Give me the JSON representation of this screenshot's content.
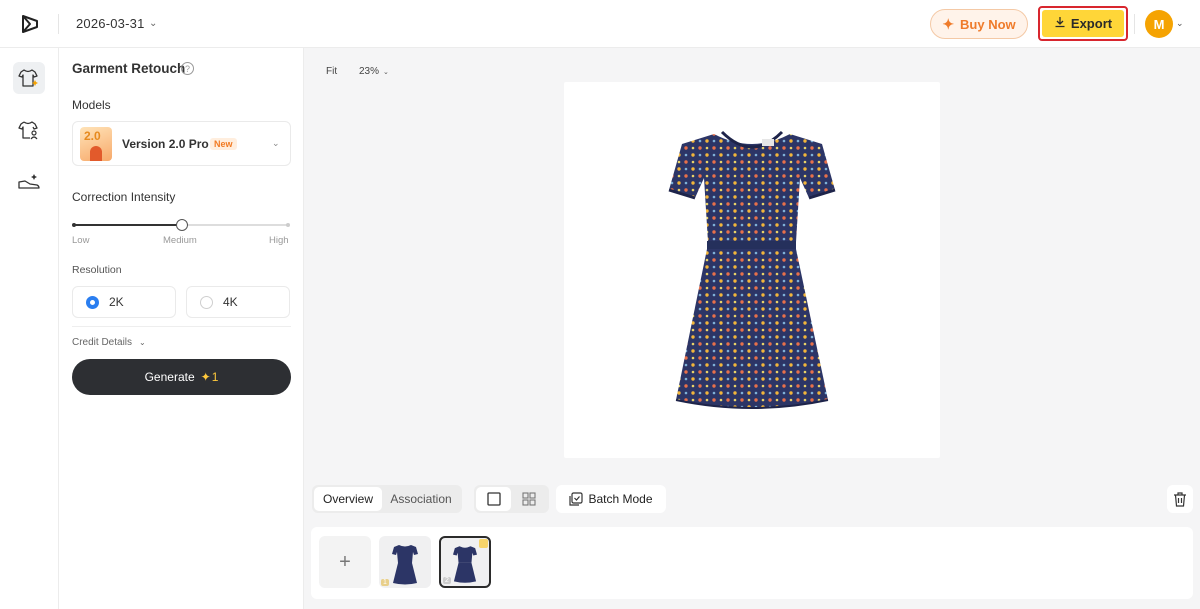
{
  "header": {
    "date": "2026-03-31",
    "buy_now": "Buy Now",
    "export": "Export",
    "avatar_initial": "M"
  },
  "rail": {
    "items": [
      "garment-retouch",
      "garment-model",
      "shoe-retouch"
    ]
  },
  "panel": {
    "title": "Garment Retouch",
    "models_label": "Models",
    "model": {
      "version_badge": "2.0",
      "name": "Version 2.0 Pro",
      "tag": "New"
    },
    "intensity_label": "Correction Intensity",
    "intensity_ticks": [
      "Low",
      "Medium",
      "High"
    ],
    "intensity_level": 0.5,
    "resolution_label": "Resolution",
    "resolutions": [
      {
        "label": "2K",
        "selected": true
      },
      {
        "label": "4K",
        "selected": false
      }
    ],
    "credit_details": "Credit Details",
    "generate": "Generate",
    "generate_cost": "1"
  },
  "toolbar": {
    "fit": "Fit",
    "zoom": "23%"
  },
  "bottom": {
    "tabs": [
      "Overview",
      "Association"
    ],
    "batch_mode": "Batch Mode",
    "thumbs": [
      {
        "index": "1",
        "selected": false
      },
      {
        "index": "2",
        "selected": true
      }
    ]
  },
  "colors": {
    "accent_yellow": "#ffd638",
    "accent_orange": "#ef7b2b",
    "dress_navy": "#2c3566",
    "highlight_red": "#d8262e",
    "radio_blue": "#2a7ef0"
  }
}
